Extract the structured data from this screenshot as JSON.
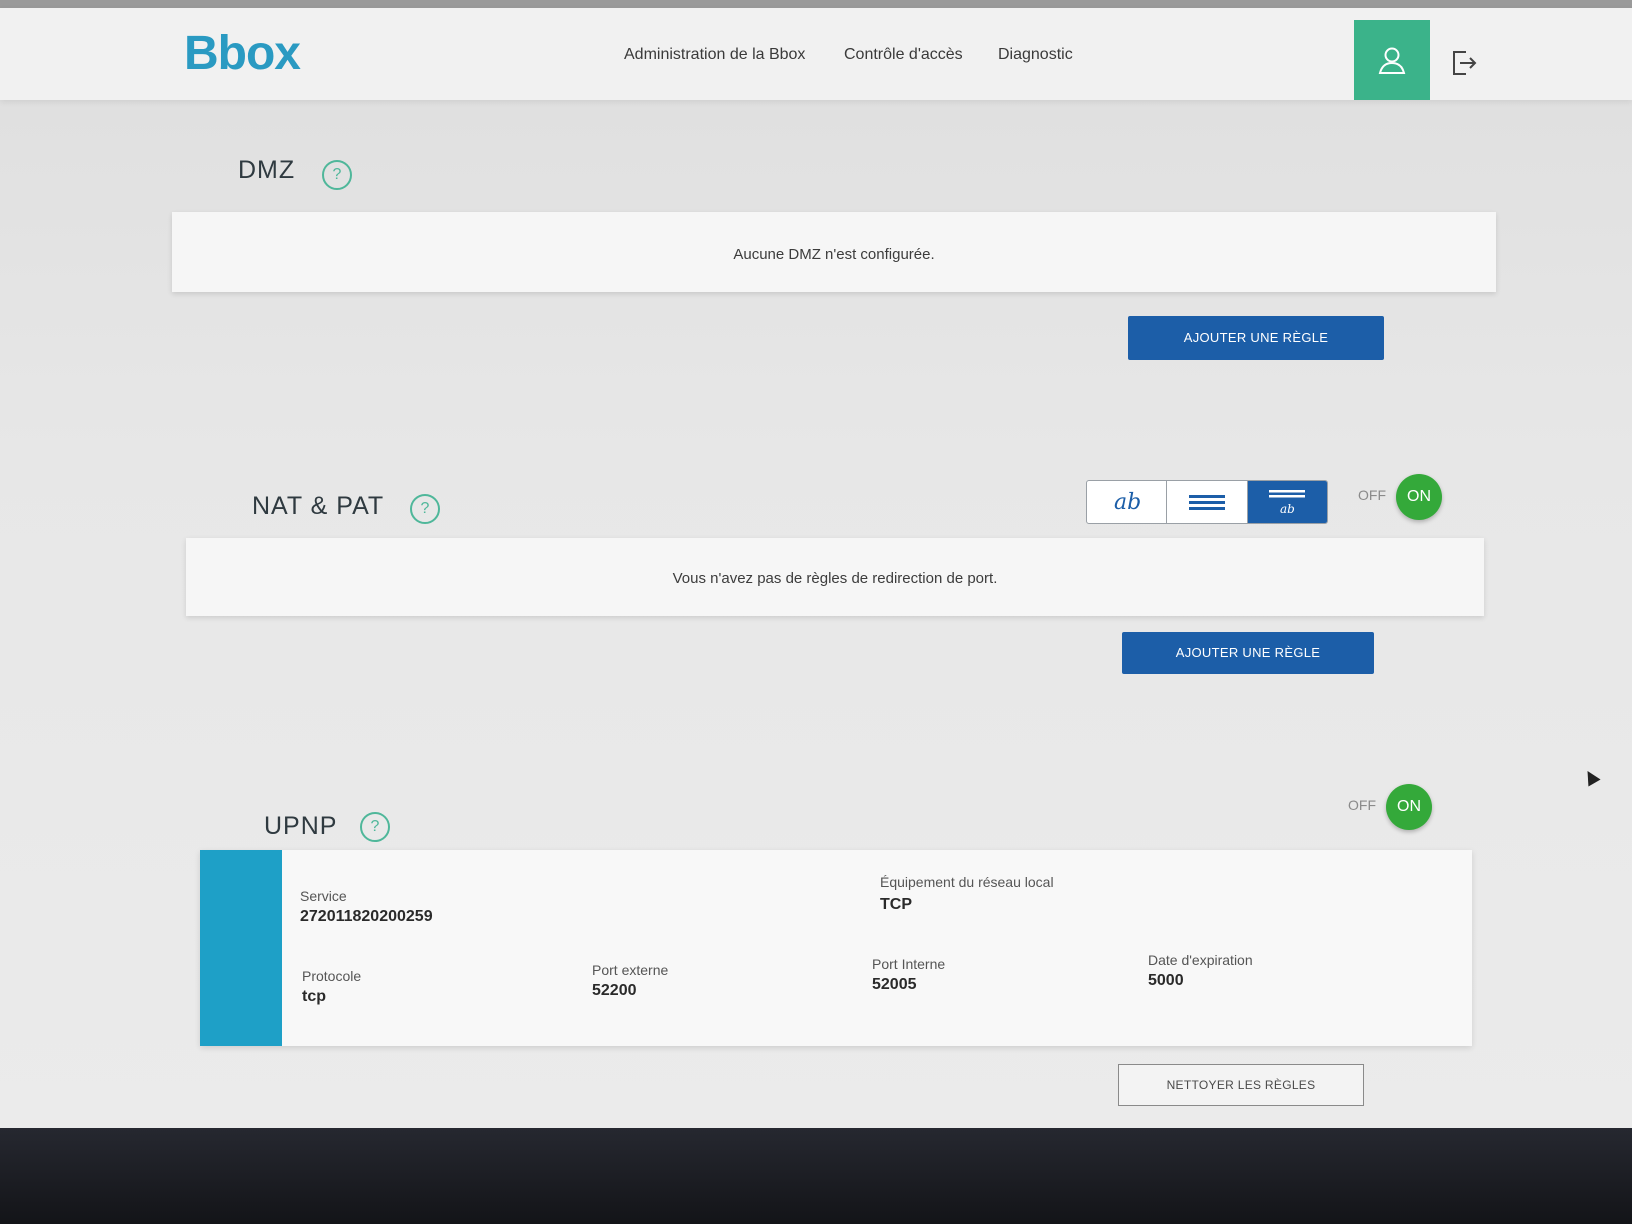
{
  "header": {
    "logo": "Bbox",
    "nav": [
      "Administration de la Bbox",
      "Contrôle d'accès",
      "Diagnostic"
    ]
  },
  "dmz": {
    "title": "DMZ",
    "help": "?",
    "empty_message": "Aucune DMZ n'est configurée.",
    "add_button": "AJOUTER UNE RÈGLE"
  },
  "nat": {
    "title": "NAT & PAT",
    "help": "?",
    "view_mode_icons": [
      "text-view-icon",
      "list-view-icon",
      "detail-view-icon"
    ],
    "active_view": 2,
    "toggle_off": "OFF",
    "toggle_on": "ON",
    "empty_message": "Vous n'avez pas de règles de redirection de port.",
    "add_button": "AJOUTER UNE RÈGLE"
  },
  "upnp": {
    "title": "UPNP",
    "help": "?",
    "toggle_off": "OFF",
    "toggle_on": "ON",
    "rule": {
      "service_label": "Service",
      "service_value": "272011820200259",
      "equipment_label": "Équipement du réseau local",
      "equipment_value": "TCP",
      "protocol_label": "Protocole",
      "protocol_value": "tcp",
      "ext_port_label": "Port externe",
      "ext_port_value": "52200",
      "int_port_label": "Port Interne",
      "int_port_value": "52005",
      "expiry_label": "Date d'expiration",
      "expiry_value": "5000"
    },
    "clean_button": "NETTOYER LES RÈGLES"
  },
  "colors": {
    "brand": "#2a9ac2",
    "accent_green": "#3bb38a",
    "primary_button": "#1c5ea8",
    "toggle_on": "#34a93a",
    "upnp_bar": "#1ea0c7"
  }
}
